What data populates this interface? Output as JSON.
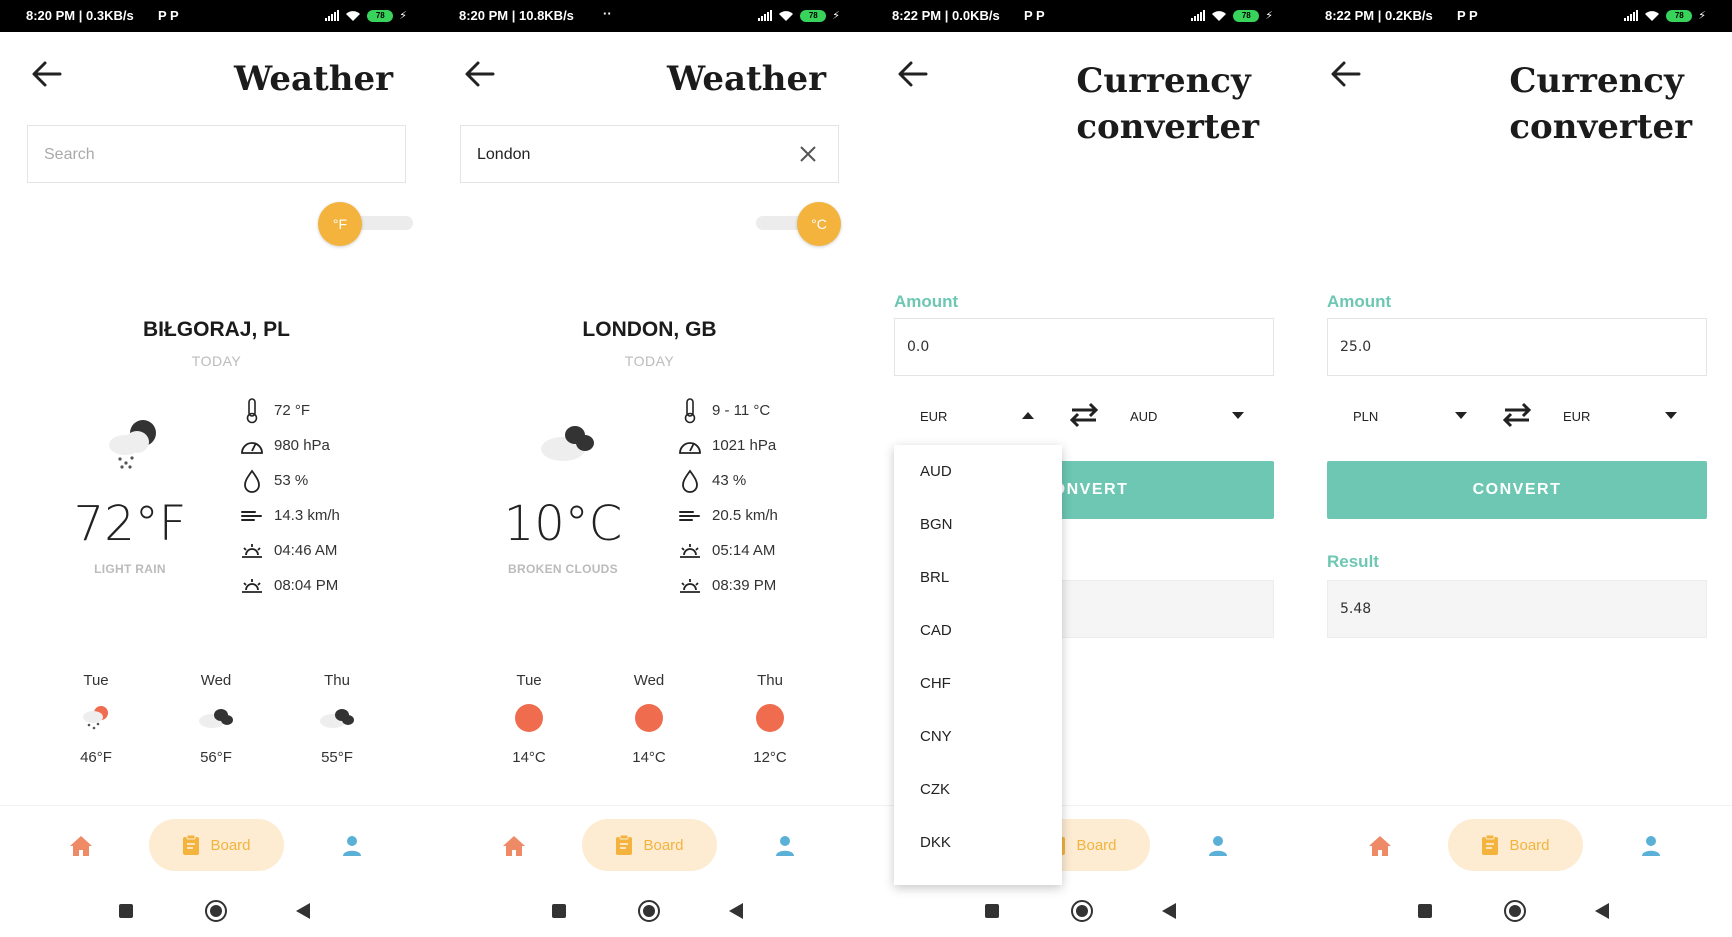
{
  "colors": {
    "accent_teal": "#6dc7b3",
    "accent_orange": "#f3b33d",
    "sun_red": "#ef6c4e",
    "board_bg": "#fdecd2"
  },
  "screens": [
    {
      "status": {
        "time": "8:20 PM | 0.3KB/s",
        "extra": "P P",
        "battery": "78"
      },
      "title": "Weather",
      "search": {
        "value": "",
        "placeholder": "Search"
      },
      "toggle": {
        "unit": "°F",
        "position": "left"
      },
      "city": "BIŁGORAJ, PL",
      "today": "TODAY",
      "current": {
        "temp": "72°F",
        "description": "LIGHT RAIN",
        "icon": "rain-cloud-moon-icon"
      },
      "details": [
        "72 °F",
        "980 hPa",
        "53 %",
        "14.3 km/h",
        "04:46 AM",
        "08:04 PM"
      ],
      "forecast": [
        {
          "day": "Tue",
          "temp": "46°F",
          "icon": "rain-sun-icon"
        },
        {
          "day": "Wed",
          "temp": "56°F",
          "icon": "cloud-icon"
        },
        {
          "day": "Thu",
          "temp": "55°F",
          "icon": "cloud-icon"
        }
      ],
      "nav": {
        "board": "Board"
      }
    },
    {
      "status": {
        "time": "8:20 PM | 10.8KB/s",
        "extra": "··",
        "battery": "78"
      },
      "title": "Weather",
      "search": {
        "value": "London",
        "placeholder": "Search"
      },
      "toggle": {
        "unit": "°C",
        "position": "right"
      },
      "city": "LONDON, GB",
      "today": "TODAY",
      "current": {
        "temp": "10°C",
        "description": "BROKEN CLOUDS",
        "icon": "broken-clouds-icon"
      },
      "details": [
        "9 - 11 °C",
        "1021 hPa",
        "43 %",
        "20.5 km/h",
        "05:14 AM",
        "08:39 PM"
      ],
      "forecast": [
        {
          "day": "Tue",
          "temp": "14°C",
          "icon": "sun-icon"
        },
        {
          "day": "Wed",
          "temp": "14°C",
          "icon": "sun-icon"
        },
        {
          "day": "Thu",
          "temp": "12°C",
          "icon": "sun-icon"
        }
      ],
      "nav": {
        "board": "Board"
      }
    },
    {
      "status": {
        "time": "8:22 PM | 0.0KB/s",
        "extra": "P P",
        "battery": "78"
      },
      "title_line1": "Currency",
      "title_line2": "converter",
      "amount_label": "Amount",
      "amount": "0.0",
      "from_currency": "EUR",
      "to_currency": "AUD",
      "convert_label": "CONVERT",
      "dropdown_options": [
        "AUD",
        "BGN",
        "BRL",
        "CAD",
        "CHF",
        "CNY",
        "CZK",
        "DKK"
      ],
      "nav": {
        "board": "Board"
      }
    },
    {
      "status": {
        "time": "8:22 PM | 0.2KB/s",
        "extra": "P P",
        "battery": "78"
      },
      "title_line1": "Currency",
      "title_line2": "converter",
      "amount_label": "Amount",
      "amount": "25.0",
      "from_currency": "PLN",
      "to_currency": "EUR",
      "convert_label": "CONVERT",
      "result_label": "Result",
      "result": "5.48",
      "nav": {
        "board": "Board"
      }
    }
  ]
}
